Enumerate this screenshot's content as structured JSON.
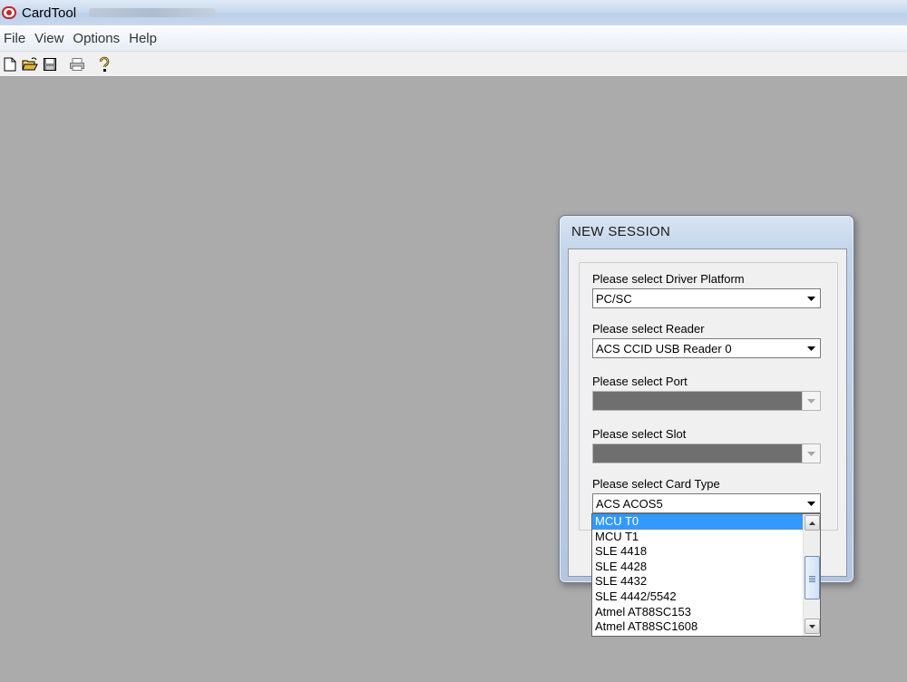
{
  "window": {
    "title": "CardTool"
  },
  "menu": [
    "File",
    "View",
    "Options",
    "Help"
  ],
  "toolbar": [
    "new-file-icon",
    "open-folder-icon",
    "save-icon",
    "print-icon",
    "help-icon"
  ],
  "dialog": {
    "title": "NEW SESSION",
    "driver_label": "Please select Driver Platform",
    "driver_value": "PC/SC",
    "reader_label": "Please select Reader",
    "reader_value": "ACS CCID USB Reader 0",
    "port_label": "Please select Port",
    "port_value": "",
    "slot_label": "Please select Slot",
    "slot_value": "",
    "cardtype_label": "Please select Card Type",
    "cardtype_value": "ACS ACOS5",
    "cardtype_options": [
      "MCU T0",
      "MCU T1",
      "SLE 4418",
      "SLE 4428",
      "SLE 4432",
      "SLE 4442/5542",
      "Atmel AT88SC153",
      "Atmel AT88SC1608"
    ],
    "highlighted_option": "MCU T0"
  },
  "colors": {
    "selection": "#3399ff",
    "workspace": "#ababab",
    "disabled_field": "#6f6f6f"
  }
}
